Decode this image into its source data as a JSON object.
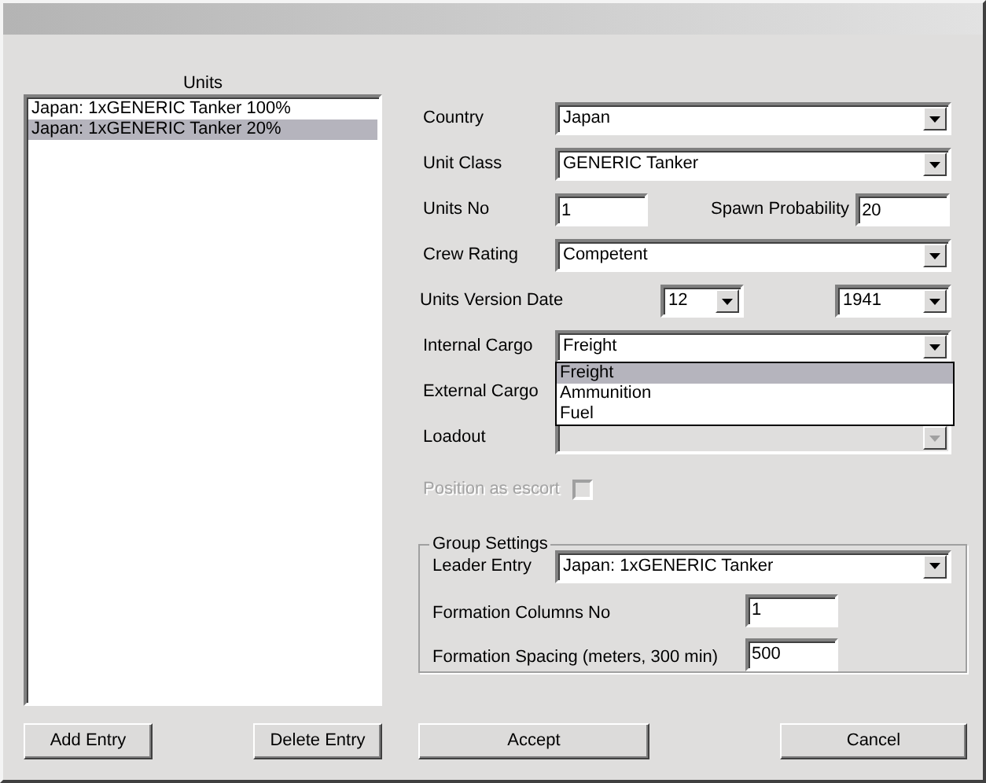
{
  "units": {
    "label": "Units",
    "items": [
      {
        "text": "Japan: 1xGENERIC Tanker 100%",
        "selected": false
      },
      {
        "text": "Japan: 1xGENERIC Tanker 20%",
        "selected": true
      }
    ]
  },
  "list_buttons": [
    "Add Entry",
    "Delete Entry"
  ],
  "fields": [
    {
      "kind": "combo",
      "label": "Country",
      "value": "Japan",
      "disabled": false
    },
    {
      "kind": "combo",
      "label": "Unit Class",
      "value": "GENERIC Tanker",
      "disabled": false
    },
    {
      "kind": "pair",
      "label": "Units No",
      "value": "1",
      "label_2": "Spawn Probability",
      "value_2": "20"
    },
    {
      "kind": "combo",
      "label": "Crew Rating",
      "value": "Competent",
      "disabled": false
    },
    {
      "kind": "date",
      "label": "Units Version Date",
      "value": "12",
      "value_2": "1941"
    },
    {
      "kind": "combo",
      "label": "Internal Cargo",
      "value": "Freight",
      "disabled": false,
      "expanded": true,
      "options": [
        {
          "text": "Freight",
          "selected": true
        },
        {
          "text": "Ammunition",
          "selected": false
        },
        {
          "text": "Fuel",
          "selected": false
        }
      ]
    },
    {
      "kind": "label",
      "label": "External Cargo"
    },
    {
      "kind": "combo",
      "label": "Loadout",
      "disabled": true
    },
    {
      "kind": "checkbox",
      "label": "Position as escort",
      "disabled": true,
      "checked": false
    }
  ],
  "group": {
    "title": "Group Settings",
    "leader": {
      "label": "Leader Entry",
      "value": "Japan: 1xGENERIC Tanker"
    },
    "fields": [
      {
        "label": "Formation Columns No",
        "value": "1"
      },
      {
        "label": "Formation Spacing (meters, 300 min)",
        "value": "500"
      }
    ]
  },
  "buttons": [
    "Accept",
    "Cancel"
  ]
}
